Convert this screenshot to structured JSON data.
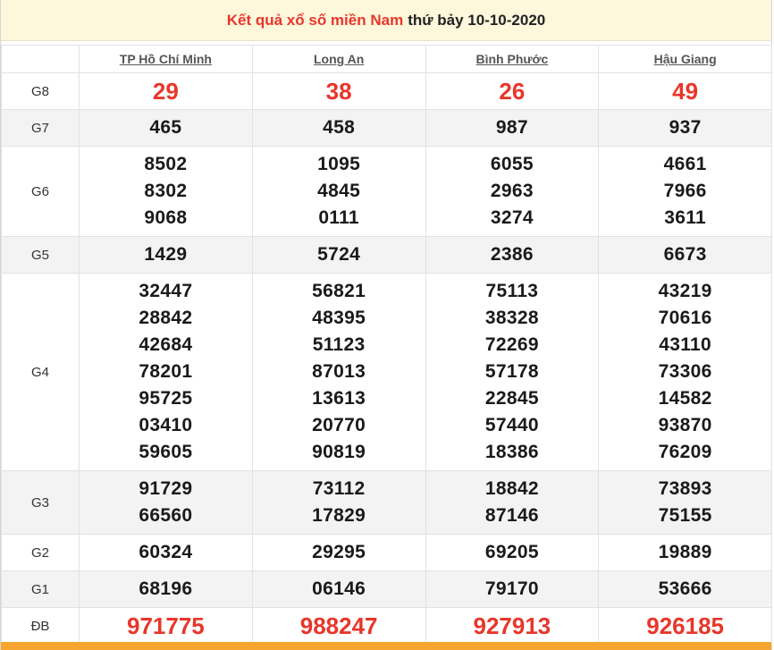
{
  "title": {
    "red_part": "Kết quả xổ số miền Nam",
    "black_part": "thứ bảy 10-10-2020"
  },
  "provinces": [
    {
      "name": "TP Hồ Chí Minh"
    },
    {
      "name": "Long An"
    },
    {
      "name": "Bình Phước"
    },
    {
      "name": "Hậu Giang"
    }
  ],
  "rows": [
    {
      "label": "G8",
      "highlight": true,
      "values": [
        [
          "29"
        ],
        [
          "38"
        ],
        [
          "26"
        ],
        [
          "49"
        ]
      ]
    },
    {
      "label": "G7",
      "highlight": false,
      "values": [
        [
          "465"
        ],
        [
          "458"
        ],
        [
          "987"
        ],
        [
          "937"
        ]
      ]
    },
    {
      "label": "G6",
      "highlight": false,
      "values": [
        [
          "8502",
          "8302",
          "9068"
        ],
        [
          "1095",
          "4845",
          "0111"
        ],
        [
          "6055",
          "2963",
          "3274"
        ],
        [
          "4661",
          "7966",
          "3611"
        ]
      ]
    },
    {
      "label": "G5",
      "highlight": false,
      "values": [
        [
          "1429"
        ],
        [
          "5724"
        ],
        [
          "2386"
        ],
        [
          "6673"
        ]
      ]
    },
    {
      "label": "G4",
      "highlight": false,
      "values": [
        [
          "32447",
          "28842",
          "42684",
          "78201",
          "95725",
          "03410",
          "59605"
        ],
        [
          "56821",
          "48395",
          "51123",
          "87013",
          "13613",
          "20770",
          "90819"
        ],
        [
          "75113",
          "38328",
          "72269",
          "57178",
          "22845",
          "57440",
          "18386"
        ],
        [
          "43219",
          "70616",
          "43110",
          "73306",
          "14582",
          "93870",
          "76209"
        ]
      ]
    },
    {
      "label": "G3",
      "highlight": false,
      "values": [
        [
          "91729",
          "66560"
        ],
        [
          "73112",
          "17829"
        ],
        [
          "18842",
          "87146"
        ],
        [
          "73893",
          "75155"
        ]
      ]
    },
    {
      "label": "G2",
      "highlight": false,
      "values": [
        [
          "60324"
        ],
        [
          "29295"
        ],
        [
          "69205"
        ],
        [
          "19889"
        ]
      ]
    },
    {
      "label": "G1",
      "highlight": false,
      "values": [
        [
          "68196"
        ],
        [
          "06146"
        ],
        [
          "79170"
        ],
        [
          "53666"
        ]
      ]
    },
    {
      "label": "ĐB",
      "highlight": true,
      "values": [
        [
          "971775"
        ],
        [
          "988247"
        ],
        [
          "927913"
        ],
        [
          "926185"
        ]
      ]
    }
  ],
  "colors": {
    "accent_red": "#e8362a",
    "title_bg": "#fdf7dc",
    "bottom_bar": "#f7a531"
  }
}
